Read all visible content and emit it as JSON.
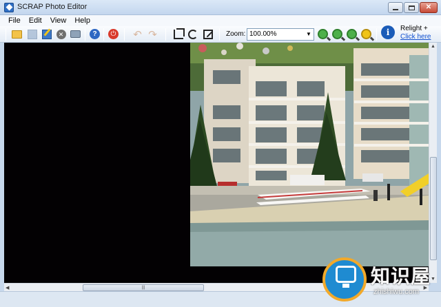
{
  "window": {
    "title": "SCRAP Photo Editor"
  },
  "menu": [
    "File",
    "Edit",
    "View",
    "Help"
  ],
  "toolbar": {
    "zoom_label": "Zoom:",
    "zoom_value": "100.00%",
    "relight_title": "Relight +",
    "relight_link": "Click here"
  },
  "icons": {
    "open": "open-folder-icon",
    "save": "save-icon",
    "edit": "edit-icon",
    "close": "close-image-icon",
    "print": "print-icon",
    "help": "help-icon",
    "exit": "power-icon",
    "undo": "undo-icon",
    "redo": "redo-icon",
    "crop": "crop-icon",
    "rotate": "rotate-icon",
    "resize": "resize-icon"
  },
  "watermark": {
    "text": "知识屋",
    "sub": "zhishiwu.com"
  }
}
